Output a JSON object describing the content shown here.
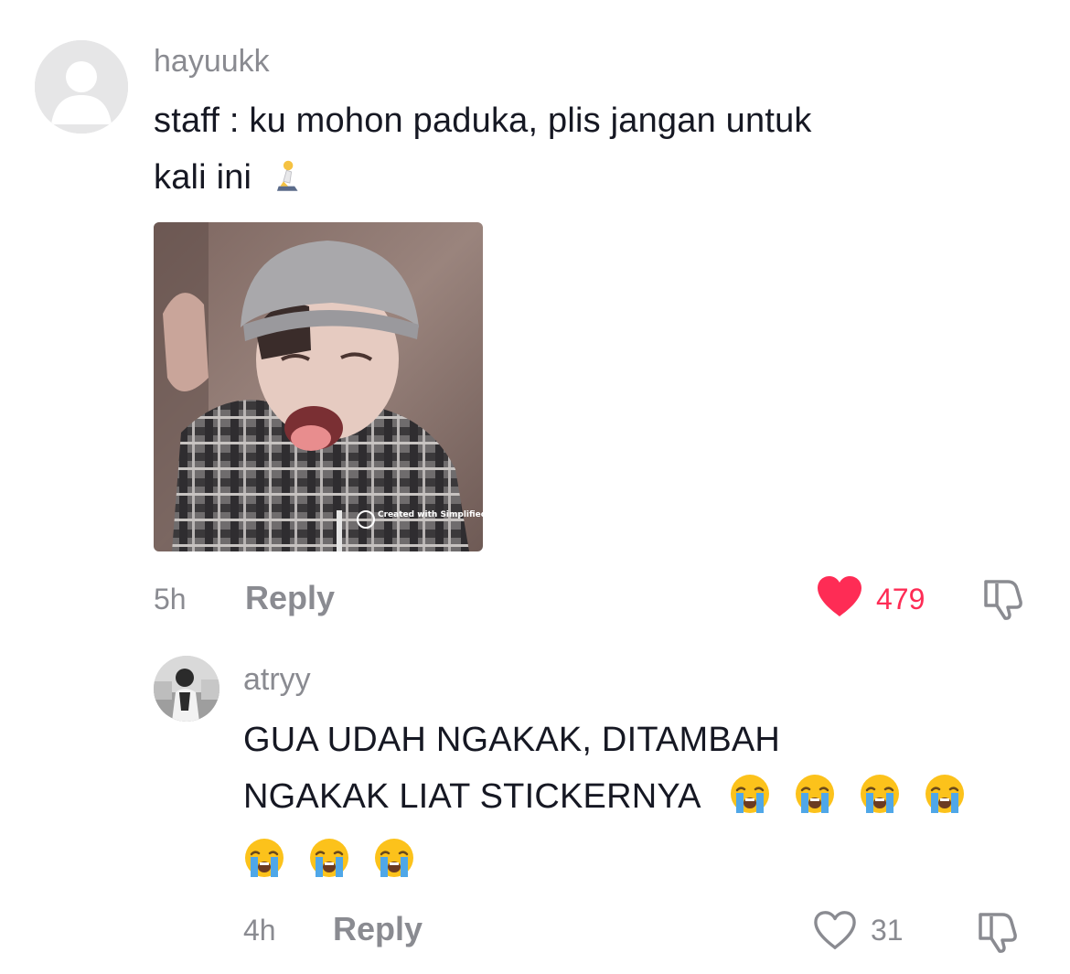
{
  "comments": [
    {
      "username": "hayuukk",
      "text_line1": "staff : ku mohon paduka, plis jangan untuk",
      "text_line2": "kali ini",
      "emoji_inline": "🧎",
      "sticker_watermark": "Created with Simplified App",
      "time": "5h",
      "reply_label": "Reply",
      "likes": "479",
      "liked": true
    },
    {
      "username": "atryy",
      "text_line1": "GUA UDAH NGAKAK, DITAMBAH",
      "text_line2": "NGAKAK LIAT STICKERNYA",
      "emoji_inline": "😭",
      "emoji_count": 7,
      "time": "4h",
      "reply_label": "Reply",
      "likes": "31",
      "liked": false
    }
  ],
  "colors": {
    "like_red": "#fe2c55",
    "meta_gray": "#8a8b91",
    "text": "#161823"
  },
  "icons": [
    "default-avatar-icon",
    "heart-filled-icon",
    "heart-outline-icon",
    "thumb-down-icon",
    "crying-face-emoji",
    "kneeling-person-emoji"
  ]
}
